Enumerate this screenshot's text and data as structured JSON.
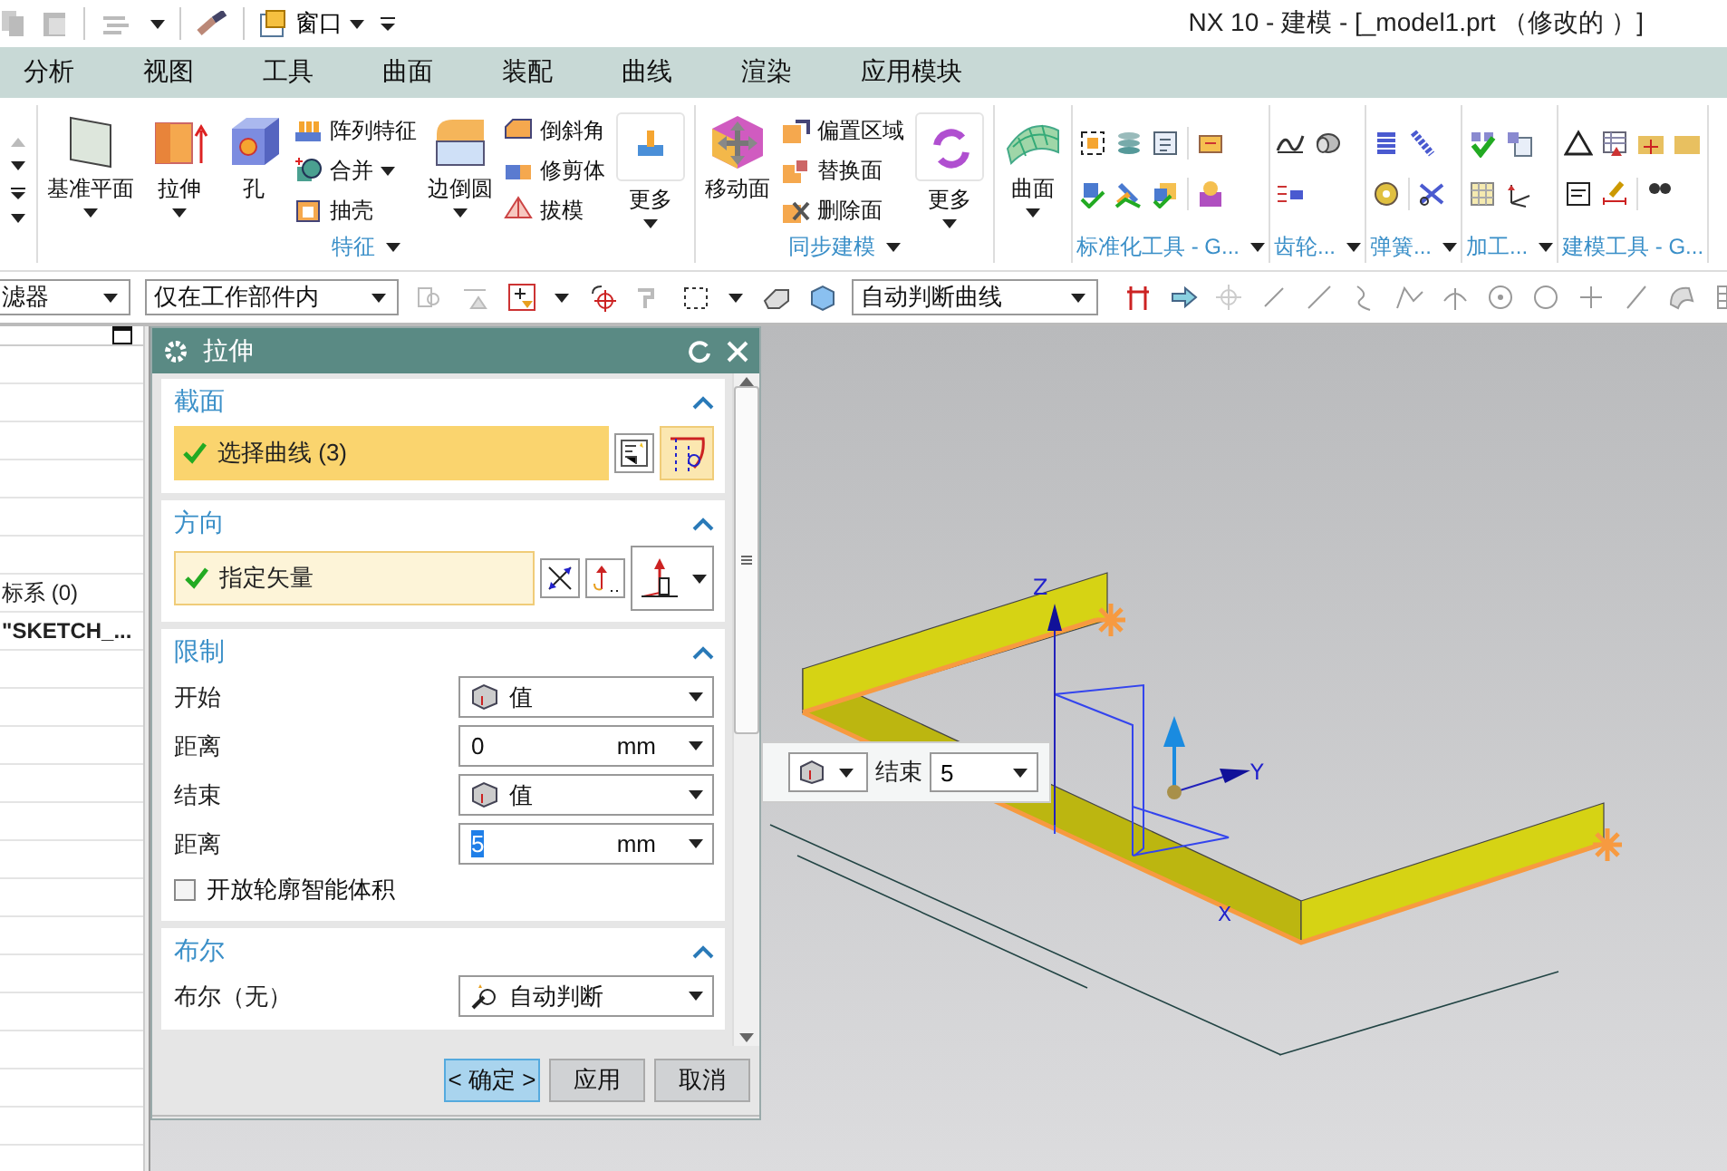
{
  "quick_access": {
    "window_menu": "窗口"
  },
  "window": {
    "title": "NX 10 - 建模 - [_model1.prt （修改的 ）]"
  },
  "menu_tabs": [
    {
      "label": "分析"
    },
    {
      "label": "视图"
    },
    {
      "label": "工具"
    },
    {
      "label": "曲面"
    },
    {
      "label": "装配"
    },
    {
      "label": "曲线"
    },
    {
      "label": "渲染"
    },
    {
      "label": "应用模块"
    }
  ],
  "ribbon": {
    "groups": [
      {
        "kind": "buttons",
        "label": "特征",
        "launcher": true,
        "columns": [
          {
            "kind": "large",
            "label": "基准平面",
            "dropdown": true
          },
          {
            "kind": "large",
            "label": "拉伸",
            "dropdown": true
          },
          {
            "kind": "large",
            "label": "孔",
            "dropdown": false
          },
          {
            "kind": "small",
            "items": [
              {
                "label": "阵列特征",
                "dropdown": false
              },
              {
                "label": "合并",
                "dropdown": true
              },
              {
                "label": "抽壳",
                "dropdown": false
              }
            ]
          },
          {
            "kind": "large",
            "label": "边倒圆",
            "dropdown": true
          },
          {
            "kind": "small",
            "items": [
              {
                "label": "倒斜角",
                "dropdown": false
              },
              {
                "label": "修剪体",
                "dropdown": false
              },
              {
                "label": "拔模",
                "dropdown": false
              }
            ]
          },
          {
            "kind": "more",
            "label": "更多",
            "dropdown": true
          }
        ]
      },
      {
        "kind": "buttons",
        "label": "同步建模",
        "launcher": true,
        "columns": [
          {
            "kind": "large",
            "label": "移动面",
            "dropdown": false
          },
          {
            "kind": "small",
            "items": [
              {
                "label": "偏置区域",
                "dropdown": false
              },
              {
                "label": "替换面",
                "dropdown": false
              },
              {
                "label": "删除面",
                "dropdown": false
              }
            ]
          },
          {
            "kind": "more",
            "label": "更多",
            "dropdown": true
          }
        ]
      },
      {
        "kind": "buttons",
        "launcher": false,
        "columns": [
          {
            "kind": "large",
            "label": "曲面",
            "dropdown": true
          }
        ]
      },
      {
        "kind": "icons",
        "label": "标准化工具 - G...",
        "launcher": true
      },
      {
        "kind": "icons",
        "label": "齿轮...",
        "launcher": true
      },
      {
        "kind": "icons",
        "label": "弹簧...",
        "launcher": true
      },
      {
        "kind": "icons",
        "label": "加工...",
        "launcher": true
      },
      {
        "kind": "icons",
        "label": "建模工具 - G...",
        "launcher": false
      }
    ]
  },
  "filter_bar": {
    "type_filter": "滤器",
    "scope": "仅在工作部件内",
    "curve_rule": "自动判断曲线"
  },
  "navigator": {
    "rows": [
      {
        "text": "标系 (0)",
        "bold": false
      },
      {
        "text": "\"SKETCH_...",
        "bold": true
      }
    ]
  },
  "dialog": {
    "title": "拉伸",
    "sections": [
      {
        "title": "截面",
        "expanded": true,
        "rows": [
          {
            "kind": "selection",
            "label": "选择曲线 (3)",
            "active": true
          }
        ]
      },
      {
        "title": "方向",
        "expanded": true,
        "rows": [
          {
            "kind": "selection",
            "label": "指定矢量",
            "active": false
          }
        ]
      },
      {
        "title": "限制",
        "expanded": true,
        "rows": [
          {
            "kind": "dropdown",
            "label": "开始",
            "value": "值"
          },
          {
            "kind": "number",
            "label": "距离",
            "value": "0",
            "unit": "mm",
            "highlighted": false
          },
          {
            "kind": "dropdown",
            "label": "结束",
            "value": "值"
          },
          {
            "kind": "number",
            "label": "距离",
            "value": "5",
            "unit": "mm",
            "highlighted": true
          },
          {
            "kind": "checkbox",
            "label": "开放轮廓智能体积",
            "checked": false
          }
        ]
      },
      {
        "title": "布尔",
        "expanded": true,
        "rows": [
          {
            "kind": "dropdown",
            "label": "布尔（无）",
            "value": "自动判断"
          }
        ]
      }
    ],
    "buttons": [
      {
        "label": "< 确定 >",
        "default": true
      },
      {
        "label": "应用",
        "default": false
      },
      {
        "label": "取消",
        "default": false
      }
    ]
  },
  "viewport": {
    "floating_toolbar": {
      "label": "结束",
      "value": "5"
    },
    "axes": {
      "z": "Z",
      "y": "Y",
      "x": "X"
    }
  }
}
